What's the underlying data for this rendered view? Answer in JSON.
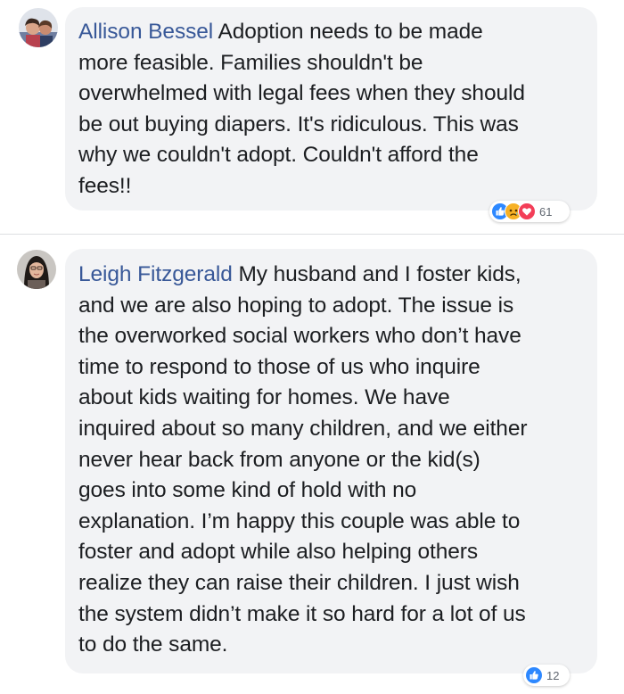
{
  "comments": [
    {
      "author": "Allison Bessel",
      "text_lines": [
        "Adoption needs to be made",
        "more feasible. Families shouldn't be",
        "overwhelmed with legal fees when they should",
        "be out buying diapers. It's ridiculous. This was",
        "why we couldn't adopt. Couldn't afford the",
        "fees!!"
      ],
      "reactions": {
        "icons": [
          "like-icon",
          "sad-icon",
          "love-icon"
        ],
        "count": "61"
      }
    },
    {
      "author": "Leigh Fitzgerald",
      "text_lines": [
        "My husband and I foster kids,",
        "and we are also hoping to adopt. The issue is",
        "the overworked social workers who don’t have",
        "time to respond to those of us who inquire",
        "about kids waiting for homes. We have",
        "inquired about so many children, and we either",
        "never hear back from anyone or the kid(s)",
        "goes into some kind of hold with no",
        "explanation. I’m happy this couple was able to",
        "foster and adopt while also helping others",
        "realize they can raise their children. I just wish",
        "the system didn’t make it so hard for a lot of us",
        "to do the same."
      ],
      "reactions": {
        "icons": [
          "like-icon"
        ],
        "count": "12"
      }
    }
  ],
  "colors": {
    "author": "#385898",
    "bubble": "#f2f3f5",
    "text": "#1c1e21",
    "like": "#2d88ff",
    "love": "#f33e58",
    "sad": "#f7b125"
  }
}
